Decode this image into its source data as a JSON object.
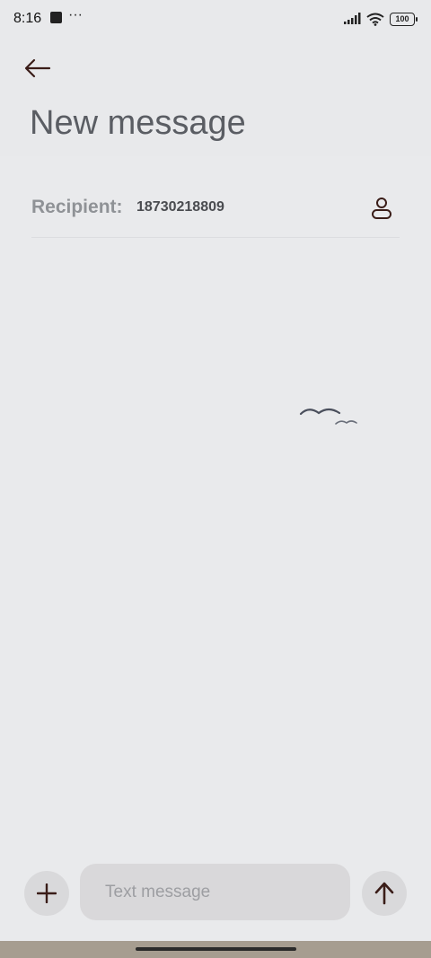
{
  "status_bar": {
    "time": "8:16",
    "dots": "···",
    "battery": "100"
  },
  "header": {
    "back_icon": "arrow-left-icon",
    "title": "New message"
  },
  "recipient": {
    "label": "Recipient:",
    "value": "18730218809",
    "contact_icon": "person-icon"
  },
  "empty_state_icon": "birds-icon",
  "composer": {
    "add_icon": "plus-icon",
    "placeholder": "Text message",
    "send_icon": "arrow-up-icon"
  },
  "colors": {
    "background": "#e9eaec",
    "icon_dark": "#3a1d18",
    "button_bg": "#d9d9db",
    "nav_strip": "#a69d90"
  }
}
